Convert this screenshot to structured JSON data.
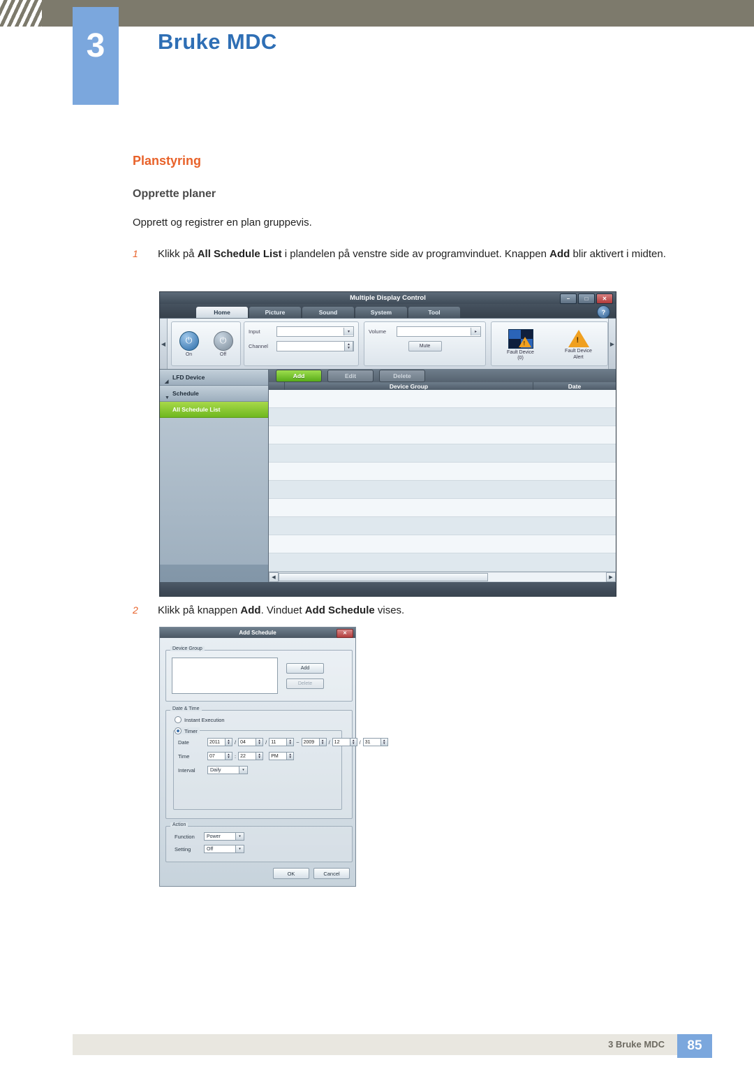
{
  "header": {
    "chapter_number": "3",
    "chapter_title": "Bruke MDC"
  },
  "content": {
    "section_title": "Planstyring",
    "sub_title": "Opprette planer",
    "intro": "Opprett og registrer en plan gruppevis.",
    "steps": [
      {
        "num": "1",
        "text_parts": {
          "a": "Klikk på ",
          "b1": "All Schedule List",
          "c": " i plandelen på venstre side av programvinduet. Knappen ",
          "b2": "Add",
          "d": " blir aktivert i midten."
        }
      },
      {
        "num": "2",
        "text_parts": {
          "a": "Klikk på knappen ",
          "b1": "Add",
          "c": ". Vinduet ",
          "b2": "Add Schedule",
          "d": " vises."
        }
      }
    ]
  },
  "mdc_window": {
    "title": "Multiple Display Control",
    "window_buttons": {
      "minimize": "–",
      "maximize": "□",
      "close": "✕"
    },
    "help_label": "?",
    "tabs": [
      {
        "label": "Home",
        "active": true
      },
      {
        "label": "Picture",
        "active": false
      },
      {
        "label": "Sound",
        "active": false
      },
      {
        "label": "System",
        "active": false
      },
      {
        "label": "Tool",
        "active": false
      }
    ],
    "ribbon": {
      "power": {
        "on_label": "On",
        "off_label": "Off"
      },
      "input_label": "Input",
      "channel_label": "Channel",
      "volume_label": "Volume",
      "mute_label": "Mute",
      "fault_device": "Fault Device",
      "fault_device_count": "(0)",
      "fault_device_alert_line1": "Fault Device",
      "fault_device_alert_line2": "Alert"
    },
    "sidebar": [
      {
        "label": "LFD Device",
        "selected": false,
        "caret": "◢"
      },
      {
        "label": "Schedule",
        "selected": false,
        "caret": "▼"
      },
      {
        "label": "All Schedule List",
        "selected": true,
        "caret": ""
      }
    ],
    "toolbar": {
      "add": "Add",
      "edit": "Edit",
      "delete": "Delete"
    },
    "table": {
      "columns": [
        "",
        "Device Group",
        "Date"
      ],
      "rows": 10
    }
  },
  "add_schedule_dialog": {
    "title": "Add Schedule",
    "close": "✕",
    "device_group": {
      "legend": "Device Group",
      "add_button": "Add",
      "delete_button": "Delete"
    },
    "date_time": {
      "legend": "Date & Time",
      "instant_execution": "Instant Execution",
      "timer": "Timer",
      "date_label": "Date",
      "date_start": {
        "year": "2011",
        "month": "04",
        "day": "11"
      },
      "range_sep": "~",
      "date_end": {
        "year": "2009",
        "month": "12",
        "day": "31"
      },
      "time_label": "Time",
      "time": {
        "hour": "07",
        "minute": "22",
        "ampm": "PM"
      },
      "interval_label": "Interval",
      "interval_value": "Daily"
    },
    "action": {
      "legend": "Action",
      "function_label": "Function",
      "function_value": "Power",
      "setting_label": "Setting",
      "setting_value": "Off"
    },
    "ok_button": "OK",
    "cancel_button": "Cancel"
  },
  "footer": {
    "text": "3 Bruke MDC",
    "page": "85"
  }
}
